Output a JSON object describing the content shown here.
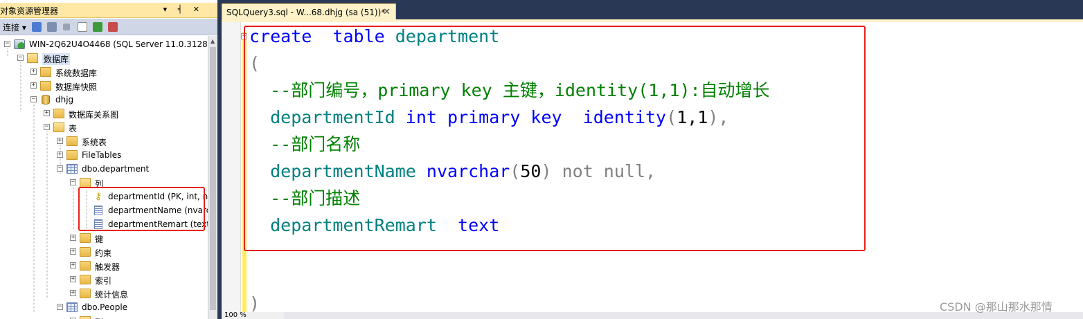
{
  "object_explorer": {
    "title": "对象资源管理器",
    "title_buttons": "▾ ╡ ✕",
    "toolbar": {
      "connect_label": "连接 ▾"
    },
    "server": "WIN-2Q62U4O4468 (SQL Server 11.0.3128 -",
    "databases": "数据库",
    "system_databases": "系统数据库",
    "snapshots": "数据库快照",
    "db_name": "dhjg",
    "diagrams": "数据库关系图",
    "tables": "表",
    "system_tables": "系统表",
    "file_tables": "FileTables",
    "table_department": "dbo.department",
    "columns": "列",
    "col1": "departmentId (PK, int, n",
    "col2": "departmentName (nvarc",
    "col3": "departmentRemart (text,",
    "keys": "键",
    "constraints": "约束",
    "triggers": "触发器",
    "indexes": "索引",
    "statistics": "统计信息",
    "table_people": "dbo.People",
    "people_columns": "列"
  },
  "editor": {
    "tab_title": "SQLQuery3.sql - W...68.dhjg (sa (51))*",
    "tab_close": "✕",
    "zoom": "100 %",
    "code": {
      "l1_kw1": "create",
      "l1_kw2": "table",
      "l1_id": "department",
      "l2": "(",
      "l3_comment": "--部门编号，primary key 主键，identity(1,1):自动增长",
      "l4_id": "departmentId",
      "l4_type": "int",
      "l4_kw1": "primary key",
      "l4_fn": "identity",
      "l4_open": "(",
      "l4_args": "1,1",
      "l4_close": "),",
      "l5_comment": "--部门名称",
      "l6_id": "departmentName",
      "l6_type": "nvarchar",
      "l6_open": "(",
      "l6_num": "50",
      "l6_rest": ") not null,",
      "l7_comment": "--部门描述",
      "l8_id": "departmentRemart",
      "l8_type": "text",
      "l9": ")"
    }
  },
  "watermark": "CSDN @那山那水那情",
  "colors": {
    "highlight": "#e8201c",
    "tab_active": "#fff2c8",
    "background": "#293955"
  }
}
